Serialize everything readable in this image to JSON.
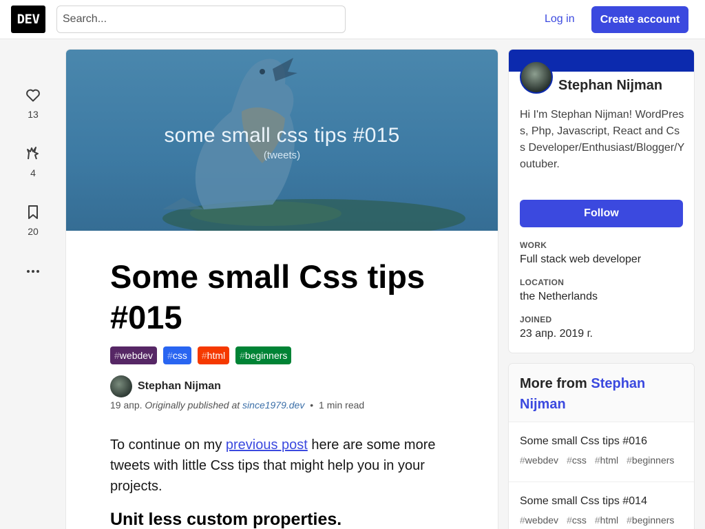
{
  "header": {
    "logo": "DEV",
    "search_placeholder": "Search...",
    "login": "Log in",
    "create_account": "Create account"
  },
  "reactions": {
    "hearts": "13",
    "unicorns": "4",
    "saves": "20"
  },
  "cover": {
    "title": "some small css tips #015",
    "subtitle": "(tweets)"
  },
  "article": {
    "title": "Some small Css tips #015",
    "tags": [
      {
        "name": "webdev",
        "color": "#562765"
      },
      {
        "name": "css",
        "color": "#2965f1"
      },
      {
        "name": "html",
        "color": "#f53900"
      },
      {
        "name": "beginners",
        "color": "#008335"
      }
    ],
    "author": "Stephan Nijman",
    "date": "19 апр.",
    "originally_published": "Originally published at",
    "source": "since1979.dev",
    "separator": "•",
    "read_time": "1 min read",
    "intro_before": "To continue on my ",
    "intro_link": "previous post",
    "intro_after": " here are some more tweets with little Css tips that might help you in your projects.",
    "subheading": "Unit less custom properties."
  },
  "profile": {
    "name": "Stephan Nijman",
    "bio": "Hi I'm Stephan Nijman! WordPress, Php, Javascript, React and Css Developer/Enthusiast/Blogger/Youtuber.",
    "follow": "Follow",
    "work_label": "WORK",
    "work": "Full stack web developer",
    "location_label": "LOCATION",
    "location": "the Netherlands",
    "joined_label": "JOINED",
    "joined": "23 апр. 2019 г."
  },
  "more_from": {
    "prefix": "More from",
    "author": "Stephan Nijman",
    "posts": [
      {
        "title": "Some small Css tips #016",
        "tags": [
          "webdev",
          "css",
          "html",
          "beginners"
        ]
      },
      {
        "title": "Some small Css tips #014",
        "tags": [
          "webdev",
          "css",
          "html",
          "beginners"
        ]
      }
    ]
  }
}
